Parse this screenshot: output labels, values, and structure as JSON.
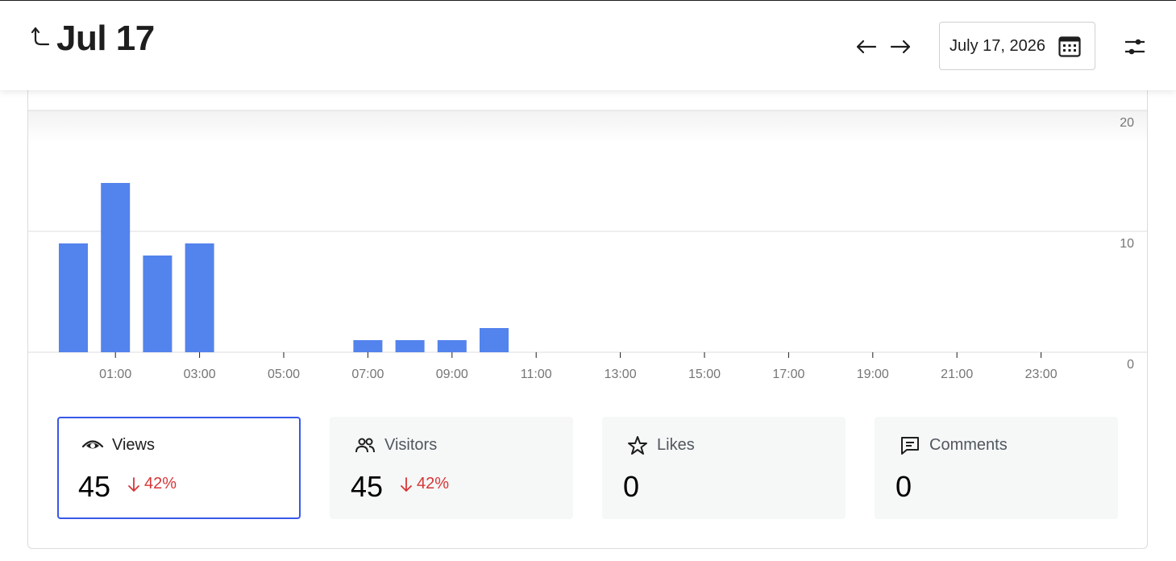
{
  "header": {
    "title": "Jul 17",
    "date_value": "July 17, 2026"
  },
  "icons": {
    "back": "back-arrow-icon",
    "prev": "arrow-left-icon",
    "next": "arrow-right-icon",
    "calendar": "calendar-icon",
    "settings": "sliders-icon"
  },
  "colors": {
    "bar": "#5383ec",
    "accent": "#3858e9",
    "negative": "#d63638"
  },
  "chart_data": {
    "type": "bar",
    "categories": [
      "00:00",
      "01:00",
      "02:00",
      "03:00",
      "04:00",
      "05:00",
      "06:00",
      "07:00",
      "08:00",
      "09:00",
      "10:00",
      "11:00",
      "12:00",
      "13:00",
      "14:00",
      "15:00",
      "16:00",
      "17:00",
      "18:00",
      "19:00",
      "20:00",
      "21:00",
      "22:00",
      "23:00"
    ],
    "values": [
      9,
      14,
      8,
      9,
      0,
      0,
      0,
      1,
      1,
      1,
      2,
      0,
      0,
      0,
      0,
      0,
      0,
      0,
      0,
      0,
      0,
      0,
      0,
      0
    ],
    "x_tick_labels": [
      "01:00",
      "03:00",
      "05:00",
      "07:00",
      "09:00",
      "11:00",
      "13:00",
      "15:00",
      "17:00",
      "19:00",
      "21:00",
      "23:00"
    ],
    "y_ticks": [
      0,
      10,
      20
    ],
    "y_tick_labels": [
      "0",
      "10",
      "20"
    ],
    "ylim": [
      0,
      20
    ],
    "grid": true
  },
  "stats": [
    {
      "label": "Views",
      "value": "45",
      "change": "42%",
      "selected": true
    },
    {
      "label": "Visitors",
      "value": "45",
      "change": "42%",
      "selected": false
    },
    {
      "label": "Likes",
      "value": "0",
      "change": "",
      "selected": false
    },
    {
      "label": "Comments",
      "value": "0",
      "change": "",
      "selected": false
    }
  ]
}
